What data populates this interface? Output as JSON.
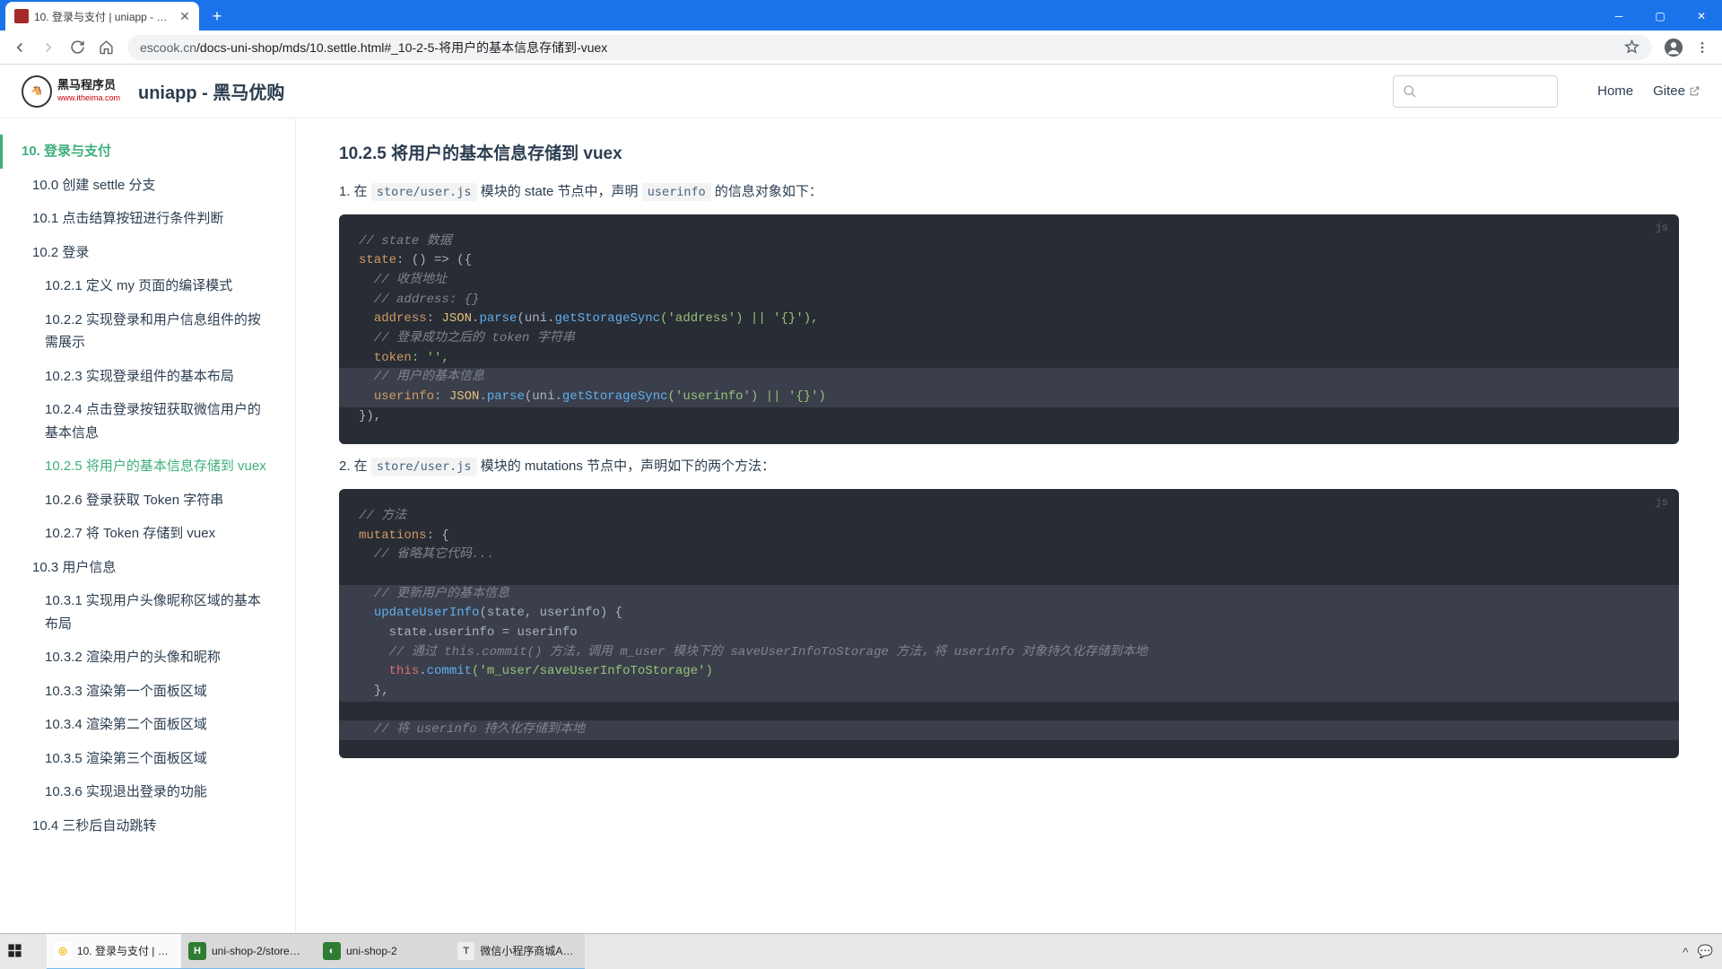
{
  "browser": {
    "tab_title": "10. 登录与支付 | uniapp - 黑马…",
    "url_grey": "escook.cn",
    "url_rest": "/docs-uni-shop/mds/10.settle.html#_10-2-5-将用户的基本信息存储到-vuex"
  },
  "header": {
    "logo_top": "黑马程序员",
    "logo_bottom": "www.itheima.com",
    "site_title": "uniapp - 黑马优购",
    "link_home": "Home",
    "link_gitee": "Gitee"
  },
  "sidebar": {
    "items": [
      {
        "lvl": 0,
        "label": "10. 登录与支付",
        "active": true
      },
      {
        "lvl": 1,
        "label": "10.0 创建 settle 分支"
      },
      {
        "lvl": 1,
        "label": "10.1 点击结算按钮进行条件判断"
      },
      {
        "lvl": 1,
        "label": "10.2 登录"
      },
      {
        "lvl": 2,
        "label": "10.2.1 定义 my 页面的编译模式"
      },
      {
        "lvl": 2,
        "label": "10.2.2 实现登录和用户信息组件的按需展示"
      },
      {
        "lvl": 2,
        "label": "10.2.3 实现登录组件的基本布局"
      },
      {
        "lvl": 2,
        "label": "10.2.4 点击登录按钮获取微信用户的基本信息"
      },
      {
        "lvl": 2,
        "label": "10.2.5 将用户的基本信息存储到 vuex",
        "activeSub": true
      },
      {
        "lvl": 2,
        "label": "10.2.6 登录获取 Token 字符串"
      },
      {
        "lvl": 2,
        "label": "10.2.7 将 Token 存储到 vuex"
      },
      {
        "lvl": 1,
        "label": "10.3 用户信息"
      },
      {
        "lvl": 2,
        "label": "10.3.1 实现用户头像昵称区域的基本布局"
      },
      {
        "lvl": 2,
        "label": "10.3.2 渲染用户的头像和昵称"
      },
      {
        "lvl": 2,
        "label": "10.3.3 渲染第一个面板区域"
      },
      {
        "lvl": 2,
        "label": "10.3.4 渲染第二个面板区域"
      },
      {
        "lvl": 2,
        "label": "10.3.5 渲染第三个面板区域"
      },
      {
        "lvl": 2,
        "label": "10.3.6 实现退出登录的功能"
      },
      {
        "lvl": 1,
        "label": "10.4 三秒后自动跳转"
      }
    ]
  },
  "content": {
    "heading": "10.2.5 将用户的基本信息存储到 vuex",
    "p1_a": "1. 在 ",
    "p1_code": "store/user.js",
    "p1_b": " 模块的 state 节点中，声明 ",
    "p1_code2": "userinfo",
    "p1_c": " 的信息对象如下：",
    "p2_a": "2. 在 ",
    "p2_code": "store/user.js",
    "p2_b": " 模块的 mutations 节点中，声明如下的两个方法：",
    "code_lang": "js",
    "code1": {
      "c1_comment1": "// state 数据",
      "c1_state": "state",
      "c1_arrow": ": () => ({",
      "c1_comment2": "// 收货地址",
      "c1_comment3": "// address: {}",
      "c1_address": "address",
      "c1_colon": ": ",
      "c1_json": "JSON",
      "c1_dot": ".",
      "c1_parse": "parse",
      "c1_open": "(uni.",
      "c1_gss": "getStorageSync",
      "c1_argA": "('address') || '{}'),",
      "c1_comment4": "// 登录成功之后的 token 字符串",
      "c1_token": "token",
      "c1_tokenVal": ": '',",
      "c1_comment5": "// 用户的基本信息",
      "c1_userinfo": "userinfo",
      "c1_argB": "('userinfo') || '{}')",
      "c1_close": "}),"
    },
    "code2": {
      "c2_comment1": "// 方法",
      "c2_mutations": "mutations",
      "c2_open": ": {",
      "c2_comment2": "// 省略其它代码...",
      "c2_comment3": "// 更新用户的基本信息",
      "c2_fn": "updateUserInfo",
      "c2_params": "(state, userinfo) {",
      "c2_assign_a": "state",
      "c2_assign_b": ".userinfo = userinfo",
      "c2_comment4": "// 通过 this.commit() 方法，调用 m_user 模块下的 saveUserInfoToStorage 方法，将 userinfo 对象持久化存储到本地",
      "c2_this": "this",
      "c2_commit": "commit",
      "c2_commitArg": "('m_user/saveUserInfoToStorage')",
      "c2_closefn": "},",
      "c2_comment5": "// 将 userinfo 持久化存储到本地"
    }
  },
  "taskbar": {
    "items": [
      {
        "label": "10. 登录与支付 | u…",
        "active": true,
        "icoBg": "#fff",
        "icoTxt": "◎",
        "icoCol": "#f4b400"
      },
      {
        "label": "uni-shop-2/store…",
        "running": true,
        "icoBg": "#2e7d32",
        "icoTxt": "H",
        "icoCol": "#fff"
      },
      {
        "label": "uni-shop-2",
        "running": true,
        "icoBg": "#2e7d32",
        "icoTxt": "◐",
        "icoCol": "#fff"
      },
      {
        "label": "微信小程序商城AP…",
        "running": true,
        "icoBg": "#eee",
        "icoTxt": "T",
        "icoCol": "#555"
      }
    ]
  }
}
